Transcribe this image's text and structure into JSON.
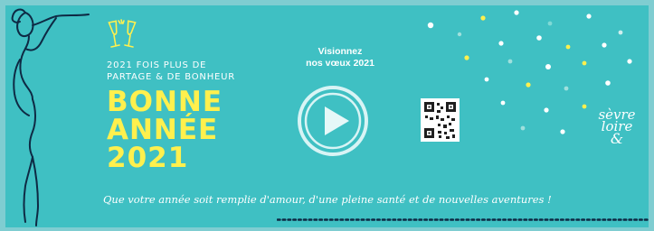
{
  "banner": {
    "tagline_line1": "2021 FOIS PLUS DE",
    "tagline_line2": "PARTAGE & DE BONHEUR",
    "headline_line1": "BONNE",
    "headline_line2": "ANNÉE",
    "headline_line3": "2021",
    "watch_line1": "Visionnez",
    "watch_line2": "nos vœux 2021",
    "wish": "Que votre année soit remplie d'amour, d'une pleine santé et de nouvelles aventures !",
    "logo_line1": "sèvre",
    "logo_line2": "loire",
    "logo_line3": "&"
  },
  "icons": {
    "play": "play-icon",
    "glasses": "champagne-glasses-icon",
    "qr": "qr-code-icon",
    "lady": "lady-silhouette-icon"
  },
  "colors": {
    "background": "#3fc0c3",
    "headline": "#fff04d",
    "text": "#ffffff"
  }
}
